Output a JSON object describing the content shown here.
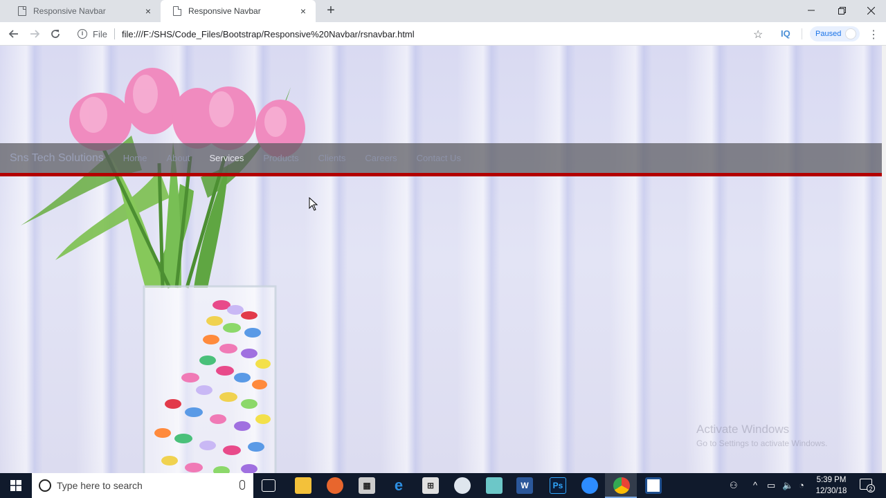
{
  "browser": {
    "tabs": [
      {
        "title": "Responsive Navbar",
        "active": false
      },
      {
        "title": "Responsive Navbar",
        "active": true
      }
    ],
    "new_tab_glyph": "+",
    "close_glyph": "×",
    "address": {
      "scheme_label": "File",
      "url": "file:///F:/SHS/Code_Files/Bootstrap/Responsive%20Navbar/rsnavbar.html"
    },
    "extension_label": "IQ",
    "profile_label": "Paused"
  },
  "page": {
    "navbar": {
      "brand": "Sns Tech Solutions",
      "links": [
        "Home",
        "About",
        "Services",
        "Products",
        "Clients",
        "Careers",
        "Contact Us"
      ],
      "highlighted": "Services",
      "accent_color": "#b30000"
    },
    "watermark": {
      "title": "Activate Windows",
      "subtitle": "Go to Settings to activate Windows."
    }
  },
  "taskbar": {
    "search_placeholder": "Type here to search",
    "clock_time": "5:39 PM",
    "clock_date": "12/30/18",
    "notification_count": "2",
    "apps": [
      "task-view-icon",
      "file-explorer-icon",
      "firefox-icon",
      "calculator-icon",
      "edge-icon",
      "store-icon",
      "app-icon",
      "app-icon",
      "word-icon",
      "photoshop-icon",
      "zoom-icon",
      "chrome-icon",
      "app-icon"
    ]
  }
}
